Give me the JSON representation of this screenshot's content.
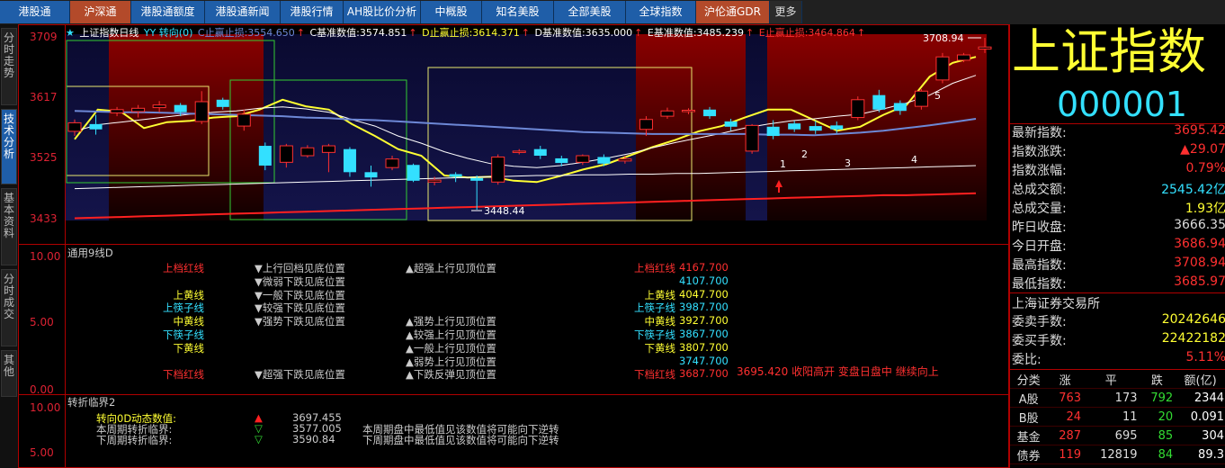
{
  "topbar": {
    "tabs": [
      {
        "label": "港股通",
        "style": "blue"
      },
      {
        "label": "沪深通",
        "style": "red"
      },
      {
        "label": "港股通额度",
        "style": "blue"
      },
      {
        "label": "港股通新闻",
        "style": "blue"
      },
      {
        "label": "港股行情",
        "style": "blue"
      },
      {
        "label": "AH股比价分析",
        "style": "blue"
      },
      {
        "label": "中概股",
        "style": "blue"
      },
      {
        "label": "知名美股",
        "style": "blue"
      },
      {
        "label": "全部美股",
        "style": "blue"
      },
      {
        "label": "全球指数",
        "style": "blue"
      },
      {
        "label": "沪伦通GDR",
        "style": "red"
      },
      {
        "label": "更多",
        "style": "dark"
      }
    ]
  },
  "sidebar": {
    "tabs": [
      "分时走势",
      "技术分析",
      "基本资料",
      "分时成交",
      "其他"
    ],
    "active": 1
  },
  "chart_main": {
    "legend": {
      "star": "★",
      "name": "上证指数日线",
      "tag": "YY 转向(0)",
      "c_stop": "C止赢止损:3554.650",
      "c_stop_arrow": "↑",
      "c_base": "C基准数值:3574.851",
      "c_base_arrow": "↑",
      "d_stop": "D止赢止损:3614.371",
      "d_stop_arrow": "↑",
      "d_base": "D基准数值:3635.000",
      "d_base_arrow": "↑",
      "e_base": "E基准数值:3485.239",
      "e_base_arrow": "↑",
      "e_stop": "E止赢止损:3464.864",
      "e_stop_arrow": "↑"
    },
    "y_ticks": [
      "3709",
      "3617",
      "3525",
      "3433"
    ],
    "high_label": "3708.94",
    "low_label": "3448.44",
    "wave_labels": [
      "1",
      "2",
      "3",
      "4",
      "5"
    ]
  },
  "panel2": {
    "title": "通用9线D",
    "y_ticks": [
      "10.00",
      "5.00",
      "0.00"
    ],
    "col1": [
      {
        "text": "上档红线",
        "color": "#ff3030"
      },
      {
        "text": "",
        "color": "#ffffff"
      },
      {
        "text": "上黄线",
        "color": "#ffff33"
      },
      {
        "text": "上筷子线",
        "color": "#33e0ff"
      },
      {
        "text": "中黄线",
        "color": "#ffff33"
      },
      {
        "text": "下筷子线",
        "color": "#33e0ff"
      },
      {
        "text": "下黄线",
        "color": "#ffff33"
      },
      {
        "text": "",
        "color": "#ffffff"
      },
      {
        "text": "下档红线",
        "color": "#ff3030"
      }
    ],
    "col2": [
      "▼上行回档见底位置",
      "▼微弱下跌见底位置",
      "▼一般下跌见底位置",
      "▼较强下跌见底位置",
      "▼强势下跌见底位置",
      "",
      "",
      "",
      "▼超强下跌见底位置"
    ],
    "col3": [
      "▲超强上行见顶位置",
      "",
      "",
      "",
      "▲强势上行见顶位置",
      "▲较强上行见顶位置",
      "▲一般上行见顶位置",
      "▲弱势上行见顶位置",
      "▲下跌反弹见顶位置"
    ],
    "col4": [
      {
        "label": "上档红线",
        "value": "4167.700",
        "color": "#ff3030",
        "vcolor": "#ff3030"
      },
      {
        "label": "",
        "value": "4107.700",
        "color": "#33e0ff",
        "vcolor": "#33e0ff"
      },
      {
        "label": "上黄线",
        "value": "4047.700",
        "color": "#ffff33",
        "vcolor": "#ffff33"
      },
      {
        "label": "上筷子线",
        "value": "3987.700",
        "color": "#33e0ff",
        "vcolor": "#33e0ff"
      },
      {
        "label": "中黄线",
        "value": "3927.700",
        "color": "#ffff33",
        "vcolor": "#ffff33"
      },
      {
        "label": "下筷子线",
        "value": "3867.700",
        "color": "#33e0ff",
        "vcolor": "#33e0ff"
      },
      {
        "label": "下黄线",
        "value": "3807.700",
        "color": "#ffff33",
        "vcolor": "#ffff33"
      },
      {
        "label": "",
        "value": "3747.700",
        "color": "#33e0ff",
        "vcolor": "#33e0ff"
      },
      {
        "label": "下档红线",
        "value": "3687.700",
        "color": "#ff3030",
        "vcolor": "#ff3030"
      }
    ],
    "comment": "3695.420 收阳高开 变盘日盘中 继续向上"
  },
  "panel3": {
    "title": "转折临界2",
    "y_ticks": [
      "10.00",
      "5.00"
    ],
    "rows": [
      {
        "label": "转向0D动态数值:",
        "icon": "▲",
        "value": "3697.455",
        "note": "",
        "color": "#ffff33",
        "icolor": "#ff2020"
      },
      {
        "label": "本周期转折临界:",
        "icon": "▽",
        "value": "3577.005",
        "note": "本周期盘中最低值见该数值将可能向下逆转",
        "color": "#cccccc",
        "icolor": "#33dd33"
      },
      {
        "label": "下周期转折临界:",
        "icon": "▽",
        "value": "3590.84",
        "note": "下周期盘中最低值见该数值将可能向下逆转",
        "color": "#cccccc",
        "icolor": "#33dd33"
      }
    ]
  },
  "quote": {
    "title": "上证指数",
    "code": "000001",
    "rows": [
      {
        "k": "最新指数:",
        "v": "3695.42",
        "color": "#ff3030"
      },
      {
        "k": "指数涨跌:",
        "v": "▲29.07",
        "color": "#ff3030"
      },
      {
        "k": "指数涨幅:",
        "v": "0.79%",
        "color": "#ff3030"
      },
      {
        "k": "总成交额:",
        "v": "2545.42亿",
        "color": "#33e0ff"
      },
      {
        "k": "总成交量:",
        "v": "1.93亿",
        "color": "#ffff33"
      },
      {
        "k": "昨日收盘:",
        "v": "3666.35",
        "color": "#dddddd"
      },
      {
        "k": "今日开盘:",
        "v": "3686.94",
        "color": "#ff3030"
      },
      {
        "k": "最高指数:",
        "v": "3708.94",
        "color": "#ff3030"
      },
      {
        "k": "最低指数:",
        "v": "3685.97",
        "color": "#ff3030"
      }
    ],
    "exchange": "上海证券交易所",
    "rows2": [
      {
        "k": "委卖手数:",
        "v": "20242646",
        "color": "#ffff33"
      },
      {
        "k": "委买手数:",
        "v": "22422182",
        "color": "#ffff33"
      },
      {
        "k": "委比:",
        "v": "5.11%",
        "color": "#ff3030"
      }
    ],
    "stats_header": [
      "分类",
      "涨",
      "平",
      "跌",
      "额(亿)"
    ],
    "stats": [
      {
        "c": "A股",
        "up": "763",
        "flat": "173",
        "down": "792",
        "amt": "2344"
      },
      {
        "c": "B股",
        "up": "24",
        "flat": "11",
        "down": "20",
        "amt": "0.091"
      },
      {
        "c": "基金",
        "up": "287",
        "flat": "695",
        "down": "85",
        "amt": "304"
      },
      {
        "c": "债券",
        "up": "119",
        "flat": "12819",
        "down": "84",
        "amt": "89.3"
      }
    ]
  },
  "chart_data": {
    "type": "candlestick",
    "title": "上证指数日线",
    "ylim": [
      3433,
      3709
    ],
    "y_ticks": [
      3433,
      3525,
      3617,
      3709
    ],
    "candles": [
      {
        "o": 3567,
        "c": 3580,
        "h": 3585,
        "l": 3560,
        "up": true
      },
      {
        "o": 3578,
        "c": 3570,
        "h": 3592,
        "l": 3562,
        "up": false
      },
      {
        "o": 3595,
        "c": 3600,
        "h": 3604,
        "l": 3590,
        "up": true
      },
      {
        "o": 3597,
        "c": 3602,
        "h": 3607,
        "l": 3588,
        "up": true
      },
      {
        "o": 3603,
        "c": 3607,
        "h": 3613,
        "l": 3596,
        "up": true
      },
      {
        "o": 3607,
        "c": 3596,
        "h": 3610,
        "l": 3590,
        "up": false
      },
      {
        "o": 3612,
        "c": 3582,
        "h": 3628,
        "l": 3578,
        "up": true
      },
      {
        "o": 3615,
        "c": 3604,
        "h": 3618,
        "l": 3600,
        "up": false
      },
      {
        "o": 3593,
        "c": 3575,
        "h": 3600,
        "l": 3568,
        "up": true
      },
      {
        "o": 3545,
        "c": 3515,
        "h": 3550,
        "l": 3508,
        "up": false
      },
      {
        "o": 3520,
        "c": 3545,
        "h": 3548,
        "l": 3512,
        "up": true
      },
      {
        "o": 3530,
        "c": 3542,
        "h": 3546,
        "l": 3527,
        "up": true
      },
      {
        "o": 3535,
        "c": 3545,
        "h": 3548,
        "l": 3505,
        "up": true
      },
      {
        "o": 3540,
        "c": 3505,
        "h": 3543,
        "l": 3498,
        "up": false
      },
      {
        "o": 3505,
        "c": 3497,
        "h": 3515,
        "l": 3483,
        "up": false
      },
      {
        "o": 3512,
        "c": 3525,
        "h": 3530,
        "l": 3508,
        "up": true
      },
      {
        "o": 3516,
        "c": 3492,
        "h": 3518,
        "l": 3490,
        "up": false
      },
      {
        "o": 3493,
        "c": 3490,
        "h": 3498,
        "l": 3485,
        "up": true
      },
      {
        "o": 3502,
        "c": 3498,
        "h": 3505,
        "l": 3490,
        "up": false
      },
      {
        "o": 3496,
        "c": 3492,
        "h": 3500,
        "l": 3448,
        "up": false
      },
      {
        "o": 3490,
        "c": 3528,
        "h": 3532,
        "l": 3486,
        "up": true
      },
      {
        "o": 3537,
        "c": 3536,
        "h": 3540,
        "l": 3532,
        "up": true
      },
      {
        "o": 3540,
        "c": 3530,
        "h": 3545,
        "l": 3525,
        "up": false
      },
      {
        "o": 3526,
        "c": 3519,
        "h": 3530,
        "l": 3514,
        "up": false
      },
      {
        "o": 3520,
        "c": 3530,
        "h": 3532,
        "l": 3516,
        "up": true
      },
      {
        "o": 3528,
        "c": 3518,
        "h": 3532,
        "l": 3514,
        "up": false
      },
      {
        "o": 3522,
        "c": 3525,
        "h": 3530,
        "l": 3518,
        "up": true
      },
      {
        "o": 3570,
        "c": 3585,
        "h": 3590,
        "l": 3560,
        "up": true
      },
      {
        "o": 3590,
        "c": 3598,
        "h": 3603,
        "l": 3586,
        "up": true
      },
      {
        "o": 3599,
        "c": 3597,
        "h": 3602,
        "l": 3593,
        "up": true
      },
      {
        "o": 3600,
        "c": 3590,
        "h": 3604,
        "l": 3586,
        "up": false
      },
      {
        "o": 3582,
        "c": 3574,
        "h": 3586,
        "l": 3568,
        "up": false
      },
      {
        "o": 3576,
        "c": 3537,
        "h": 3578,
        "l": 3533,
        "up": true
      },
      {
        "o": 3574,
        "c": 3560,
        "h": 3584,
        "l": 3555,
        "up": false
      },
      {
        "o": 3579,
        "c": 3570,
        "h": 3583,
        "l": 3566,
        "up": false
      },
      {
        "o": 3575,
        "c": 3568,
        "h": 3583,
        "l": 3563,
        "up": false
      },
      {
        "o": 3576,
        "c": 3570,
        "h": 3582,
        "l": 3564,
        "up": false
      },
      {
        "o": 3588,
        "c": 3615,
        "h": 3620,
        "l": 3584,
        "up": true
      },
      {
        "o": 3600,
        "c": 3622,
        "h": 3630,
        "l": 3596,
        "up": false
      },
      {
        "o": 3610,
        "c": 3598,
        "h": 3614,
        "l": 3592,
        "up": false
      },
      {
        "o": 3605,
        "c": 3628,
        "h": 3631,
        "l": 3600,
        "up": true
      },
      {
        "o": 3645,
        "c": 3680,
        "h": 3686,
        "l": 3640,
        "up": true
      },
      {
        "o": 3675,
        "c": 3683,
        "h": 3686,
        "l": 3672,
        "up": true
      },
      {
        "o": 3692,
        "c": 3695,
        "h": 3709,
        "l": 3686,
        "up": true
      }
    ],
    "series": [
      {
        "name": "yellow",
        "values": [
          3555,
          3600,
          3597,
          3572,
          3581,
          3583,
          3588,
          3590,
          3600,
          3615,
          3605,
          3600,
          3578,
          3560,
          3540,
          3530,
          3500,
          3497,
          3498,
          3492,
          3490,
          3499,
          3509,
          3517,
          3530,
          3543,
          3554,
          3567,
          3575,
          3588,
          3600,
          3600,
          3584,
          3568,
          3574,
          3592,
          3607,
          3650,
          3671,
          3680
        ]
      },
      {
        "name": "white",
        "values": [
          3567,
          3577,
          3581,
          3585,
          3589,
          3593,
          3596,
          3598,
          3602,
          3604,
          3601,
          3596,
          3585,
          3575,
          3560,
          3549,
          3536,
          3526,
          3518,
          3514,
          3512,
          3515,
          3520,
          3526,
          3533,
          3542,
          3550,
          3557,
          3564,
          3572,
          3578,
          3583,
          3586,
          3590,
          3593,
          3601,
          3610,
          3622,
          3640,
          3652
        ]
      },
      {
        "name": "blue",
        "values": [
          3598,
          3597,
          3596,
          3596,
          3595,
          3594,
          3593,
          3592,
          3591,
          3590,
          3588,
          3587,
          3585,
          3584,
          3582,
          3580,
          3578,
          3576,
          3574,
          3572,
          3570,
          3568,
          3566,
          3565,
          3564,
          3563,
          3563,
          3563,
          3563,
          3563,
          3562,
          3562,
          3561,
          3563,
          3565,
          3568,
          3572,
          3576,
          3581,
          3586
        ]
      },
      {
        "name": "white_low",
        "values": [
          3480,
          3481,
          3482,
          3483,
          3484,
          3485,
          3486,
          3487,
          3488,
          3489,
          3490,
          3491,
          3492,
          3493,
          3494,
          3495,
          3496,
          3497,
          3498,
          3499,
          3500,
          3500,
          3501,
          3501,
          3502,
          3502,
          3503,
          3503,
          3504,
          3505,
          3506,
          3507,
          3508,
          3509,
          3510,
          3511,
          3512,
          3513,
          3514,
          3515
        ]
      },
      {
        "name": "red",
        "values": [
          3435,
          3436,
          3437,
          3438,
          3439,
          3440,
          3441,
          3442,
          3443,
          3444,
          3445,
          3446,
          3447,
          3448,
          3449,
          3450,
          3451,
          3452,
          3453,
          3454,
          3455,
          3456,
          3457,
          3458,
          3459,
          3460,
          3461,
          3462,
          3463,
          3464,
          3465,
          3466,
          3467,
          3468,
          3469,
          3470,
          3470,
          3471,
          3472,
          3473
        ]
      }
    ]
  },
  "colors": {
    "up": "#ff3030",
    "down": "#33e0ff",
    "grid": "#b00000",
    "yellow": "#ffff33"
  }
}
